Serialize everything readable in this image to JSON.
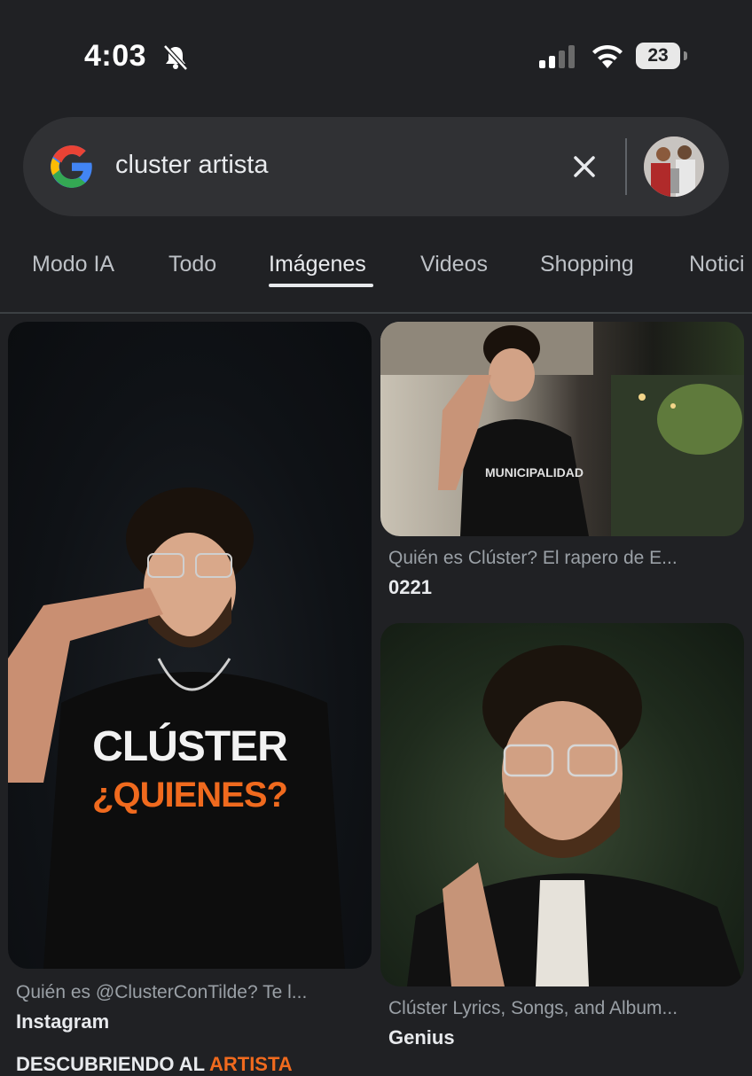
{
  "status_bar": {
    "time": "4:03",
    "battery": "23"
  },
  "search": {
    "query": "cluster artista"
  },
  "tabs": [
    {
      "label": "Modo IA"
    },
    {
      "label": "Todo"
    },
    {
      "label": "Imágenes"
    },
    {
      "label": "Videos"
    },
    {
      "label": "Shopping"
    },
    {
      "label": "Notici"
    }
  ],
  "active_tab": "Imágenes",
  "results": [
    {
      "caption": "Quién es @ClusterConTilde? Te l...",
      "source": "Instagram",
      "overlay_line1": "CLÚSTER",
      "overlay_line2": "¿QUIENES?"
    },
    {
      "caption": "Quién es Clúster? El rapero de E...",
      "source": "0221"
    },
    {
      "caption": "Clúster Lyrics, Songs, and Album...",
      "source": "Genius"
    }
  ],
  "bottom_peek": {
    "white": "DESCUBRIENDO AL",
    "orange": "ARTISTA"
  },
  "colors": {
    "background": "#202124",
    "search_bar": "#303134",
    "accent_orange": "#f06a1e"
  }
}
